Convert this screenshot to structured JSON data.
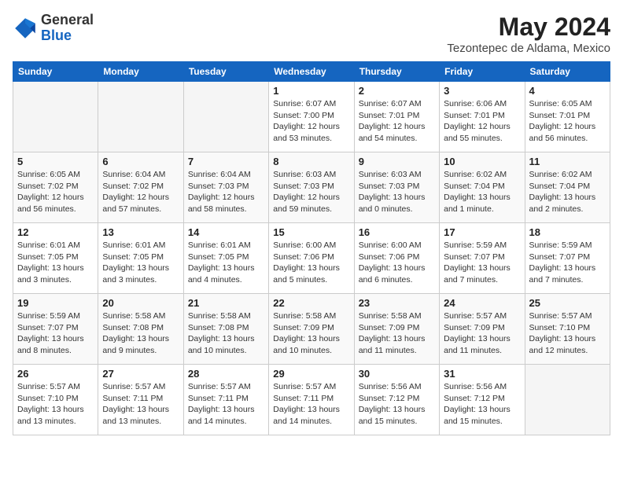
{
  "logo": {
    "general": "General",
    "blue": "Blue"
  },
  "header": {
    "month_year": "May 2024",
    "location": "Tezontepec de Aldama, Mexico"
  },
  "weekdays": [
    "Sunday",
    "Monday",
    "Tuesday",
    "Wednesday",
    "Thursday",
    "Friday",
    "Saturday"
  ],
  "weeks": [
    [
      {
        "day": "",
        "info": ""
      },
      {
        "day": "",
        "info": ""
      },
      {
        "day": "",
        "info": ""
      },
      {
        "day": "1",
        "info": "Sunrise: 6:07 AM\nSunset: 7:00 PM\nDaylight: 12 hours\nand 53 minutes."
      },
      {
        "day": "2",
        "info": "Sunrise: 6:07 AM\nSunset: 7:01 PM\nDaylight: 12 hours\nand 54 minutes."
      },
      {
        "day": "3",
        "info": "Sunrise: 6:06 AM\nSunset: 7:01 PM\nDaylight: 12 hours\nand 55 minutes."
      },
      {
        "day": "4",
        "info": "Sunrise: 6:05 AM\nSunset: 7:01 PM\nDaylight: 12 hours\nand 56 minutes."
      }
    ],
    [
      {
        "day": "5",
        "info": "Sunrise: 6:05 AM\nSunset: 7:02 PM\nDaylight: 12 hours\nand 56 minutes."
      },
      {
        "day": "6",
        "info": "Sunrise: 6:04 AM\nSunset: 7:02 PM\nDaylight: 12 hours\nand 57 minutes."
      },
      {
        "day": "7",
        "info": "Sunrise: 6:04 AM\nSunset: 7:03 PM\nDaylight: 12 hours\nand 58 minutes."
      },
      {
        "day": "8",
        "info": "Sunrise: 6:03 AM\nSunset: 7:03 PM\nDaylight: 12 hours\nand 59 minutes."
      },
      {
        "day": "9",
        "info": "Sunrise: 6:03 AM\nSunset: 7:03 PM\nDaylight: 13 hours\nand 0 minutes."
      },
      {
        "day": "10",
        "info": "Sunrise: 6:02 AM\nSunset: 7:04 PM\nDaylight: 13 hours\nand 1 minute."
      },
      {
        "day": "11",
        "info": "Sunrise: 6:02 AM\nSunset: 7:04 PM\nDaylight: 13 hours\nand 2 minutes."
      }
    ],
    [
      {
        "day": "12",
        "info": "Sunrise: 6:01 AM\nSunset: 7:05 PM\nDaylight: 13 hours\nand 3 minutes."
      },
      {
        "day": "13",
        "info": "Sunrise: 6:01 AM\nSunset: 7:05 PM\nDaylight: 13 hours\nand 3 minutes."
      },
      {
        "day": "14",
        "info": "Sunrise: 6:01 AM\nSunset: 7:05 PM\nDaylight: 13 hours\nand 4 minutes."
      },
      {
        "day": "15",
        "info": "Sunrise: 6:00 AM\nSunset: 7:06 PM\nDaylight: 13 hours\nand 5 minutes."
      },
      {
        "day": "16",
        "info": "Sunrise: 6:00 AM\nSunset: 7:06 PM\nDaylight: 13 hours\nand 6 minutes."
      },
      {
        "day": "17",
        "info": "Sunrise: 5:59 AM\nSunset: 7:07 PM\nDaylight: 13 hours\nand 7 minutes."
      },
      {
        "day": "18",
        "info": "Sunrise: 5:59 AM\nSunset: 7:07 PM\nDaylight: 13 hours\nand 7 minutes."
      }
    ],
    [
      {
        "day": "19",
        "info": "Sunrise: 5:59 AM\nSunset: 7:07 PM\nDaylight: 13 hours\nand 8 minutes."
      },
      {
        "day": "20",
        "info": "Sunrise: 5:58 AM\nSunset: 7:08 PM\nDaylight: 13 hours\nand 9 minutes."
      },
      {
        "day": "21",
        "info": "Sunrise: 5:58 AM\nSunset: 7:08 PM\nDaylight: 13 hours\nand 10 minutes."
      },
      {
        "day": "22",
        "info": "Sunrise: 5:58 AM\nSunset: 7:09 PM\nDaylight: 13 hours\nand 10 minutes."
      },
      {
        "day": "23",
        "info": "Sunrise: 5:58 AM\nSunset: 7:09 PM\nDaylight: 13 hours\nand 11 minutes."
      },
      {
        "day": "24",
        "info": "Sunrise: 5:57 AM\nSunset: 7:09 PM\nDaylight: 13 hours\nand 11 minutes."
      },
      {
        "day": "25",
        "info": "Sunrise: 5:57 AM\nSunset: 7:10 PM\nDaylight: 13 hours\nand 12 minutes."
      }
    ],
    [
      {
        "day": "26",
        "info": "Sunrise: 5:57 AM\nSunset: 7:10 PM\nDaylight: 13 hours\nand 13 minutes."
      },
      {
        "day": "27",
        "info": "Sunrise: 5:57 AM\nSunset: 7:11 PM\nDaylight: 13 hours\nand 13 minutes."
      },
      {
        "day": "28",
        "info": "Sunrise: 5:57 AM\nSunset: 7:11 PM\nDaylight: 13 hours\nand 14 minutes."
      },
      {
        "day": "29",
        "info": "Sunrise: 5:57 AM\nSunset: 7:11 PM\nDaylight: 13 hours\nand 14 minutes."
      },
      {
        "day": "30",
        "info": "Sunrise: 5:56 AM\nSunset: 7:12 PM\nDaylight: 13 hours\nand 15 minutes."
      },
      {
        "day": "31",
        "info": "Sunrise: 5:56 AM\nSunset: 7:12 PM\nDaylight: 13 hours\nand 15 minutes."
      },
      {
        "day": "",
        "info": ""
      }
    ]
  ]
}
